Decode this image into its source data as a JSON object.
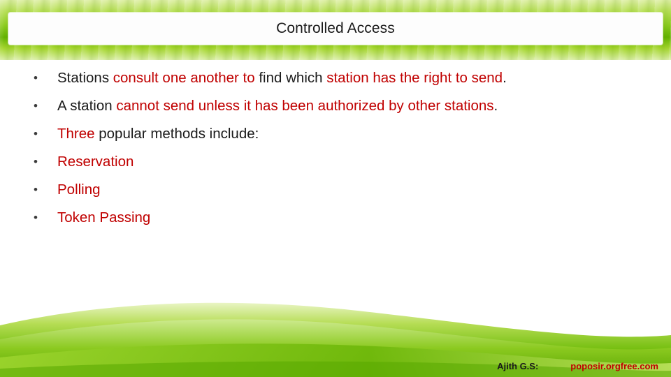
{
  "slide": {
    "title": "Controlled Access",
    "bullet_glyph": "•",
    "bullets": [
      {
        "segments": [
          {
            "text": "Stations ",
            "color": "#1a1a1a"
          },
          {
            "text": "consult one another to ",
            "color": "#c00000"
          },
          {
            "text": "find which ",
            "color": "#1a1a1a"
          },
          {
            "text": "station has the right to send",
            "color": "#c00000"
          },
          {
            "text": ".",
            "color": "#1a1a1a"
          }
        ]
      },
      {
        "segments": [
          {
            "text": "A station ",
            "color": "#1a1a1a"
          },
          {
            "text": "cannot send unless it has been authorized by other stations",
            "color": "#c00000"
          },
          {
            "text": ".",
            "color": "#1a1a1a"
          }
        ]
      },
      {
        "segments": [
          {
            "text": " Three ",
            "color": "#c00000"
          },
          {
            "text": "popular methods include:",
            "color": "#1a1a1a"
          }
        ]
      },
      {
        "segments": [
          {
            "text": "Reservation",
            "color": "#c00000"
          }
        ]
      },
      {
        "segments": [
          {
            "text": "Polling",
            "color": "#c00000"
          }
        ]
      },
      {
        "segments": [
          {
            "text": "Token Passing",
            "color": "#c00000"
          }
        ]
      }
    ],
    "footer": {
      "author": "Ajith G.S:",
      "site": "poposir.orgfree.com"
    },
    "colors": {
      "accent_red": "#c00000",
      "text_black": "#1a1a1a",
      "band_green": "#8ccc1f"
    }
  }
}
